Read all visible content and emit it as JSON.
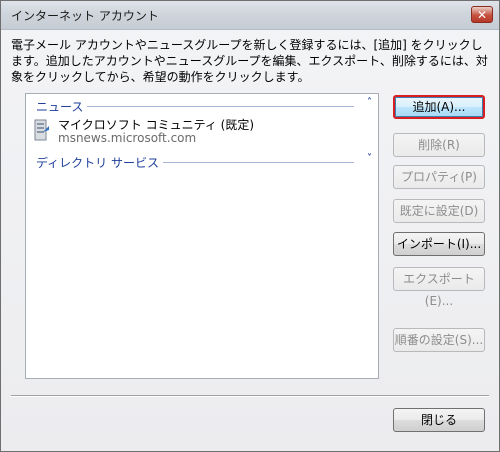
{
  "window": {
    "title": "インターネット アカウント",
    "close_label": "✕"
  },
  "description": "電子メール アカウントやニュースグループを新しく登録するには、[追加] をクリックします。追加したアカウントやニュースグループを編集、エクスポート、削除するには、対象をクリックしてから、希望の動作をクリックします。",
  "groups": [
    {
      "label": "ニュース",
      "chevron": "˄",
      "items": [
        {
          "name": "マイクロソフト コミュニティ (既定)",
          "server": "msnews.microsoft.com",
          "icon": "news-server-icon"
        }
      ]
    },
    {
      "label": "ディレクトリ サービス",
      "chevron": "˅",
      "items": []
    }
  ],
  "buttons": {
    "add": "追加(A)...",
    "delete": "削除(R)",
    "properties": "プロパティ(P)",
    "set_default": "既定に設定(D)",
    "import": "インポート(I)...",
    "export": "エクスポート(E)...",
    "order": "順番の設定(S)...",
    "close": "閉じる"
  },
  "colors": {
    "group_header": "#1e3f9c",
    "highlight_border": "#d81e1e"
  }
}
